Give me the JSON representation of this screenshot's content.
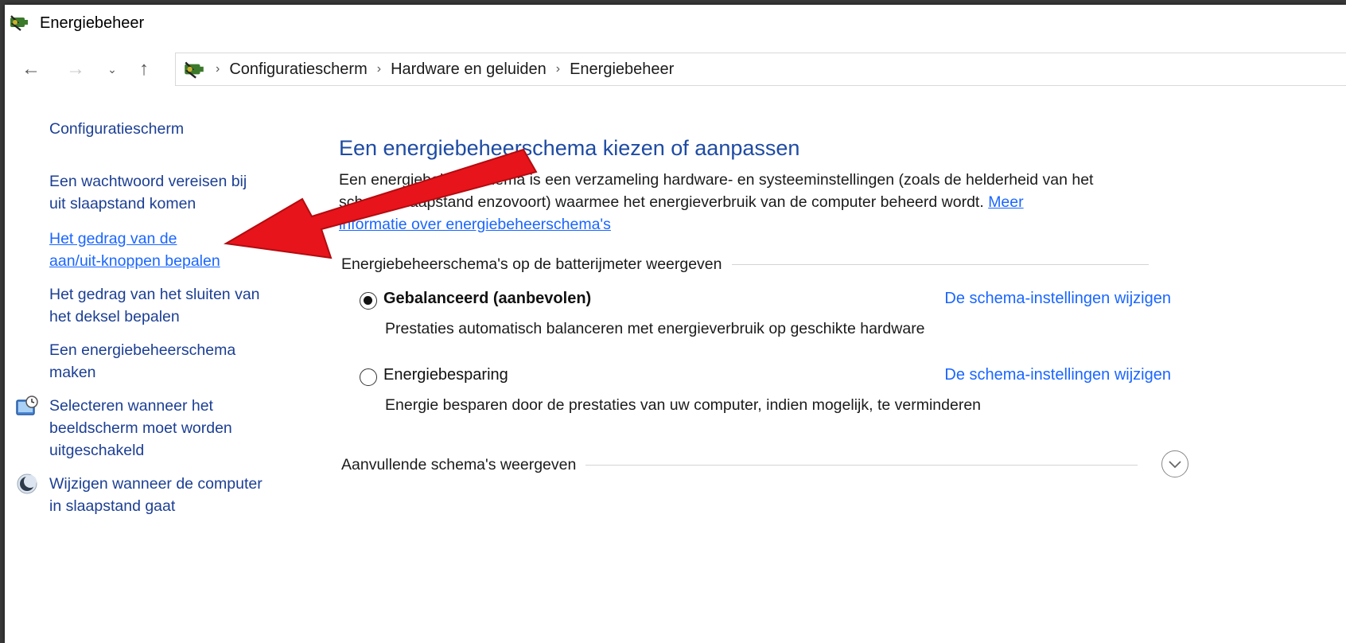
{
  "window": {
    "title": "Energiebeheer"
  },
  "nav": {
    "back_icon": "back-arrow-icon",
    "forward_icon": "forward-arrow-icon",
    "recent_icon": "chevron-down-icon",
    "up_icon": "up-arrow-icon"
  },
  "breadcrumb": [
    "Configuratiescherm",
    "Hardware en geluiden",
    "Energiebeheer"
  ],
  "sidebar": {
    "home": "Configuratiescherm",
    "links": [
      {
        "line1": "Een wachtwoord vereisen bij",
        "line2": "uit slaapstand komen"
      },
      {
        "line1": "Het gedrag van de",
        "line2": "aan/uit-knoppen bepalen"
      },
      {
        "line1": "Het gedrag van het sluiten van",
        "line2": "het deksel bepalen"
      },
      {
        "line1": "Een energiebeheerschema",
        "line2": "maken"
      },
      {
        "line1": "Selecteren wanneer het",
        "line2": "beeldscherm moet worden",
        "line3": "uitgeschakeld"
      },
      {
        "line1": "Wijzigen wanneer de computer",
        "line2": "in slaapstand gaat"
      }
    ]
  },
  "main": {
    "heading": "Een energiebeheerschema kiezen of aanpassen",
    "desc_line1": "Een energiebeheerschema is een verzameling hardware- en systeeminstellingen (zoals de helderheid van het",
    "desc_line2": "scherm, slaapstand enzovoort) waarmee het energieverbruik van de computer beheerd wordt.",
    "desc_link_a": "Meer",
    "desc_link_b": "informatie over energiebeheerschema's",
    "section1": "Energiebeheerschema's op de batterijmeter weergeven",
    "plans": [
      {
        "name": "Gebalanceerd (aanbevolen)",
        "link": "De schema-instellingen wijzigen",
        "desc": "Prestaties automatisch balanceren met energieverbruik op geschikte hardware",
        "selected": true
      },
      {
        "name": "Energiebesparing",
        "link": "De schema-instellingen wijzigen",
        "desc": "Energie besparen door de prestaties van uw computer, indien mogelijk, te verminderen",
        "selected": false
      }
    ],
    "section2": "Aanvullende schema's weergeven"
  },
  "colors": {
    "heading": "#1e4ba3",
    "link": "#1a66ff",
    "sidebar_link": "#1c3f94",
    "annotation_arrow": "#e8141b"
  }
}
